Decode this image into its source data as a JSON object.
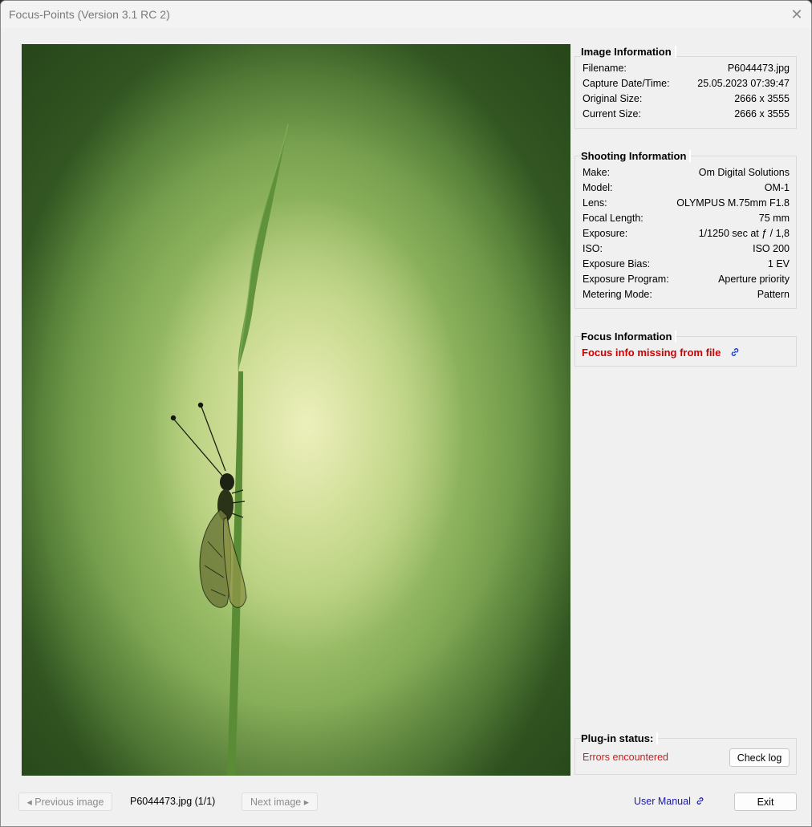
{
  "window": {
    "title": "Focus-Points (Version 3.1 RC 2)"
  },
  "image_info": {
    "title": "Image Information",
    "rows": [
      {
        "label": "Filename:",
        "value": "P6044473.jpg"
      },
      {
        "label": "Capture Date/Time:",
        "value": "25.05.2023 07:39:47"
      },
      {
        "label": "Original Size:",
        "value": "2666 x 3555"
      },
      {
        "label": "Current Size:",
        "value": "2666 x 3555"
      }
    ]
  },
  "shooting_info": {
    "title": "Shooting Information",
    "rows": [
      {
        "label": "Make:",
        "value": "Om Digital Solutions"
      },
      {
        "label": "Model:",
        "value": "OM-1"
      },
      {
        "label": "Lens:",
        "value": "OLYMPUS M.75mm F1.8"
      },
      {
        "label": "Focal Length:",
        "value": "75 mm"
      },
      {
        "label": "Exposure:",
        "value": "1/1250 sec at ƒ / 1,8"
      },
      {
        "label": "ISO:",
        "value": "ISO 200"
      },
      {
        "label": "Exposure Bias:",
        "value": "1 EV"
      },
      {
        "label": "Exposure Program:",
        "value": "Aperture priority"
      },
      {
        "label": "Metering Mode:",
        "value": "Pattern"
      }
    ]
  },
  "focus_info": {
    "title": "Focus Information",
    "message": "Focus info missing from file",
    "link_icon": "link-icon"
  },
  "plugin_status": {
    "title": "Plug-in status:",
    "status": "Errors encountered",
    "check_log_label": "Check log"
  },
  "footer": {
    "prev_label": "◂ Previous image",
    "file_label": "P6044473.jpg (1/1)",
    "next_label": "Next image ▸",
    "user_manual_label": "User Manual",
    "exit_label": "Exit"
  },
  "colors": {
    "error_red": "#d10000",
    "link_blue": "#1a1aa6"
  }
}
